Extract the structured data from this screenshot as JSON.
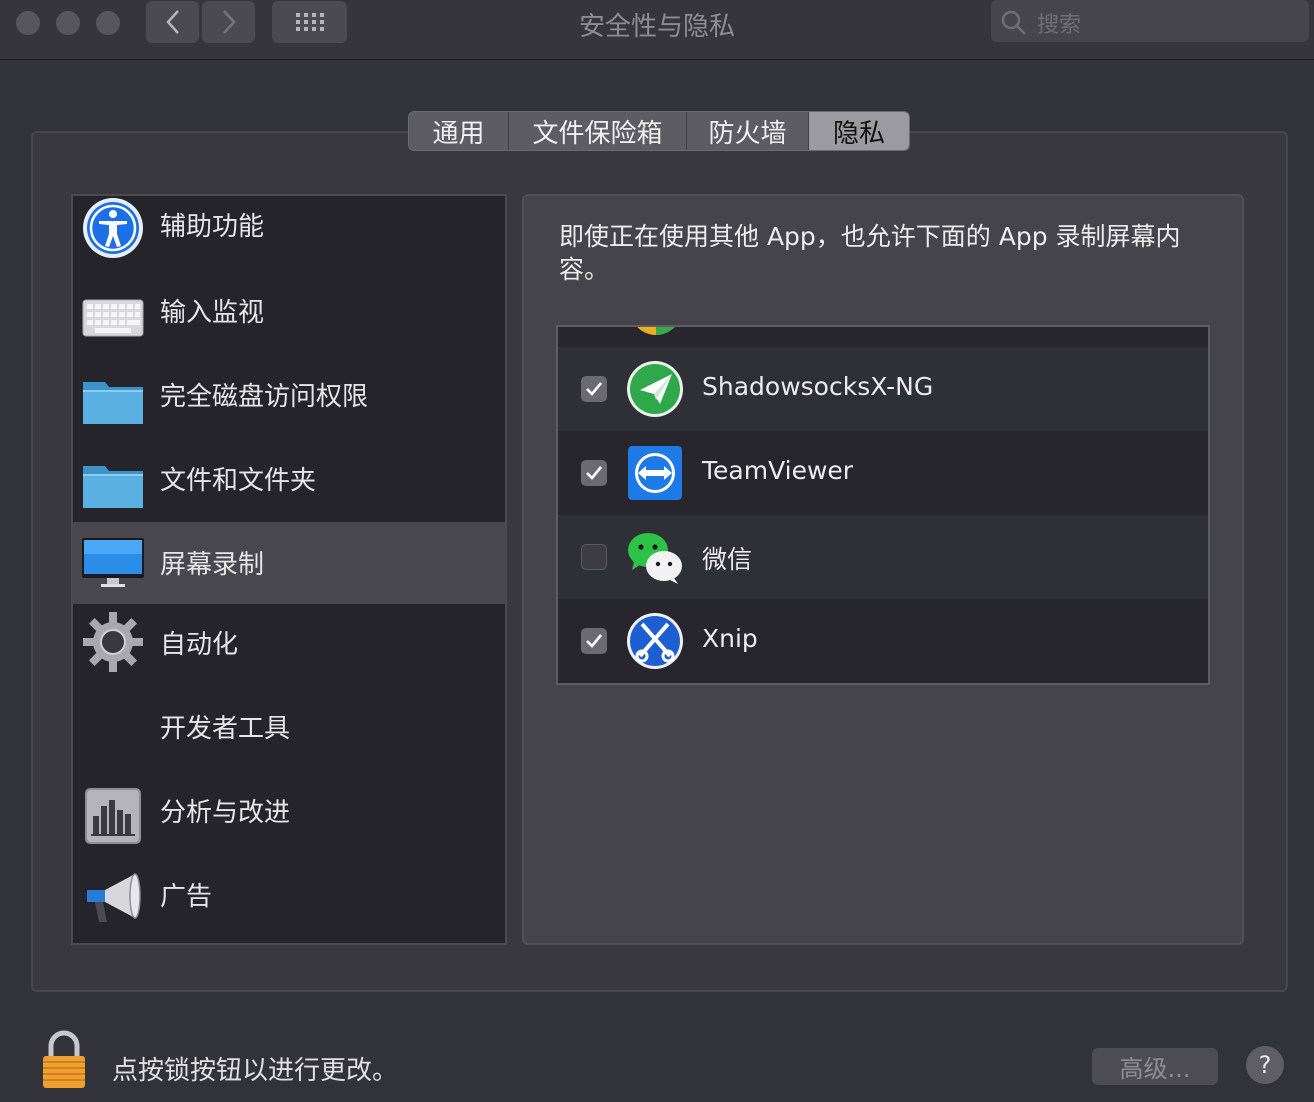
{
  "window": {
    "title": "安全性与隐私",
    "search_placeholder": "搜索"
  },
  "tabs": [
    {
      "label": "通用",
      "active": false
    },
    {
      "label": "文件保险箱",
      "active": false
    },
    {
      "label": "防火墙",
      "active": false
    },
    {
      "label": "隐私",
      "active": true
    }
  ],
  "sidebar": {
    "items": [
      {
        "label": "辅助功能",
        "icon": "accessibility-icon"
      },
      {
        "label": "输入监视",
        "icon": "keyboard-icon"
      },
      {
        "label": "完全磁盘访问权限",
        "icon": "folder-icon"
      },
      {
        "label": "文件和文件夹",
        "icon": "folder-icon"
      },
      {
        "label": "屏幕录制",
        "icon": "display-icon",
        "selected": true
      },
      {
        "label": "自动化",
        "icon": "gear-icon"
      },
      {
        "label": "开发者工具",
        "icon": ""
      },
      {
        "label": "分析与改进",
        "icon": "bar-chart-icon"
      },
      {
        "label": "广告",
        "icon": "megaphone-icon"
      }
    ]
  },
  "main": {
    "description": "即使正在使用其他 App，也允许下面的 App 录制屏幕内容。",
    "apps": [
      {
        "name": "ShadowsocksX-NG",
        "checked": true,
        "icon": "paper-plane-icon"
      },
      {
        "name": "TeamViewer",
        "checked": true,
        "icon": "teamviewer-icon"
      },
      {
        "name": "微信",
        "checked": false,
        "icon": "wechat-icon"
      },
      {
        "name": "Xnip",
        "checked": true,
        "icon": "scissors-icon"
      }
    ]
  },
  "footer": {
    "lock_text": "点按锁按钮以进行更改。",
    "advanced_label": "高级...",
    "help_label": "?"
  },
  "colors": {
    "background": "#323239",
    "accent_blue": "#1e6fe0"
  }
}
